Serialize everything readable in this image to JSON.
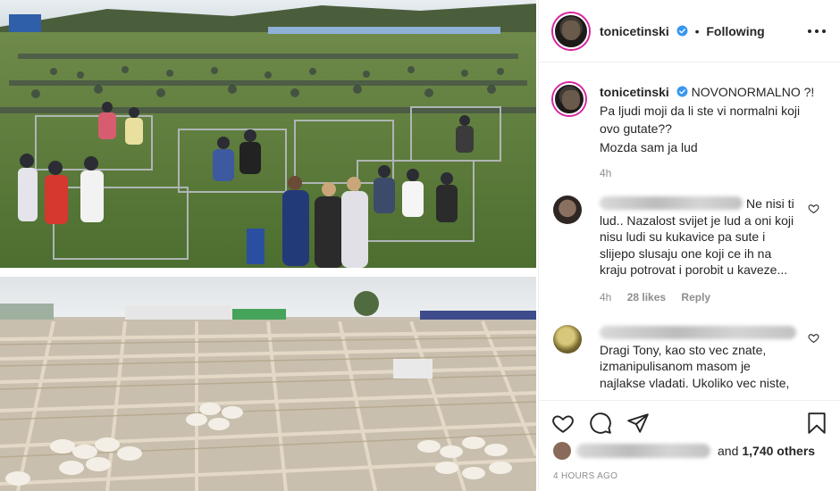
{
  "header": {
    "username": "tonicetinski",
    "separator": "•",
    "follow_status": "Following"
  },
  "caption": {
    "username": "tonicetinski",
    "lines": [
      "NOVONORMALNO ?!",
      "Pa ljudi moji da li ste vi normalni koji ovo gutate??",
      "Mozda sam ja lud"
    ],
    "time": "4h"
  },
  "comments": [
    {
      "text": "Ne nisi ti lud.. Nazalost svijet je lud a oni koji nisu ludi su kukavice pa sute i slijepo slusaju one koji ce ih na kraju potrovat i porobit u kaveze...",
      "time": "4h",
      "likes": "28 likes",
      "reply": "Reply"
    },
    {
      "text": "Dragi Tony, kao sto vec znate, izmanipulisanom masom je najlakse vladati. Ukoliko vec niste,",
      "time": "",
      "likes": "",
      "reply": ""
    }
  ],
  "likes_bar": {
    "and_text": "and",
    "others": "1,740 others"
  },
  "time_ago": "4 HOURS AGO",
  "icons": [
    "verified-icon",
    "more-options-icon",
    "heart-icon",
    "comment-icon",
    "share-icon",
    "bookmark-icon"
  ],
  "colors": {
    "text": "#262626",
    "muted": "#8e8e8e",
    "verified": "#3897f0",
    "border": "#efefef"
  }
}
